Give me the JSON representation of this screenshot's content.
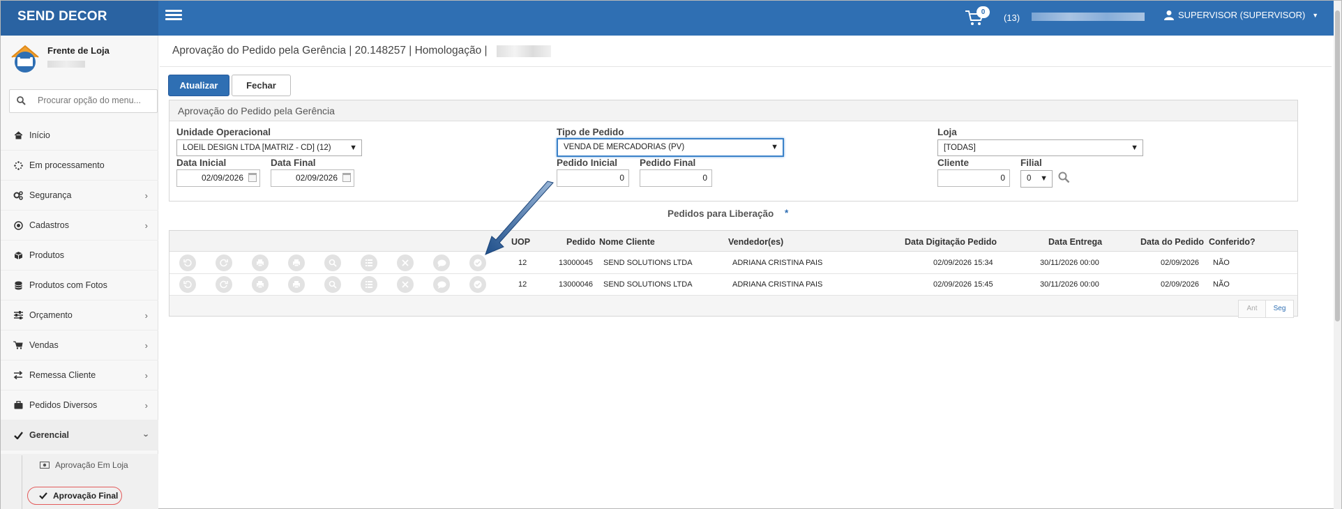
{
  "app": {
    "brand": "SEND DECOR",
    "cart_count": "0",
    "notifications": "(13)",
    "user": "SUPERVISOR (SUPERVISOR)"
  },
  "sidebar": {
    "store_name": "Frente de Loja",
    "search_placeholder": "Procurar opção do menu...",
    "items": [
      {
        "label": "Início",
        "icon": "home-icon"
      },
      {
        "label": "Em processamento",
        "icon": "spinner-icon"
      },
      {
        "label": "Segurança",
        "icon": "gears-icon"
      },
      {
        "label": "Cadastros",
        "icon": "target-icon"
      },
      {
        "label": "Produtos",
        "icon": "box-icon"
      },
      {
        "label": "Produtos com Fotos",
        "icon": "database-icon"
      },
      {
        "label": "Orçamento",
        "icon": "sliders-icon"
      },
      {
        "label": "Vendas",
        "icon": "cart-icon"
      },
      {
        "label": "Remessa Cliente",
        "icon": "exchange-icon"
      },
      {
        "label": "Pedidos Diversos",
        "icon": "briefcase-icon"
      },
      {
        "label": "Gerencial",
        "icon": "check-icon"
      }
    ],
    "submenu": [
      {
        "label": "Aprovação Em Loja"
      },
      {
        "label": "Aprovação Final"
      }
    ]
  },
  "page": {
    "title": "Aprovação do Pedido pela Gerência | 20.148257 | Homologação |",
    "btn_update": "Atualizar",
    "btn_close": "Fechar"
  },
  "filters": {
    "panel_title": "Aprovação do Pedido pela Gerência",
    "unit_label": "Unidade Operacional",
    "unit_value": "LOEIL DESIGN LTDA [MATRIZ - CD] (12)",
    "order_type_label": "Tipo de Pedido",
    "order_type_value": "VENDA DE MERCADORIAS (PV)",
    "store_label": "Loja",
    "store_value": "[TODAS]",
    "start_date_label": "Data Inicial",
    "start_date_value": "02/09/2026",
    "end_date_label": "Data Final",
    "end_date_value": "02/09/2026",
    "start_order_label": "Pedido Inicial",
    "start_order_value": "0",
    "end_order_label": "Pedido Final",
    "end_order_value": "0",
    "client_label": "Cliente",
    "client_value": "0",
    "branch_label": "Filial",
    "branch_value": "0"
  },
  "grid": {
    "title": "Pedidos para Liberação",
    "required_mark": "*",
    "columns": [
      "UOP",
      "Pedido",
      "Nome Cliente",
      "Vendedor(es)",
      "Data Digitação Pedido",
      "Data Entrega",
      "Data do Pedido",
      "Conferido?"
    ],
    "rows": [
      {
        "uop": "12",
        "pedido": "13000045",
        "cliente": "SEND SOLUTIONS LTDA",
        "vendedor": "ADRIANA CRISTINA PAIS",
        "digitacao": "02/09/2026 15:34",
        "entrega": "30/11/2026 00:00",
        "data_pedido": "02/09/2026",
        "conferido": "NÃO"
      },
      {
        "uop": "12",
        "pedido": "13000046",
        "cliente": "SEND SOLUTIONS LTDA",
        "vendedor": "ADRIANA CRISTINA PAIS",
        "digitacao": "02/09/2026 15:45",
        "entrega": "30/11/2026 00:00",
        "data_pedido": "02/09/2026",
        "conferido": "NÃO"
      }
    ],
    "pager_prev": "Ant",
    "pager_next": "Seg"
  }
}
